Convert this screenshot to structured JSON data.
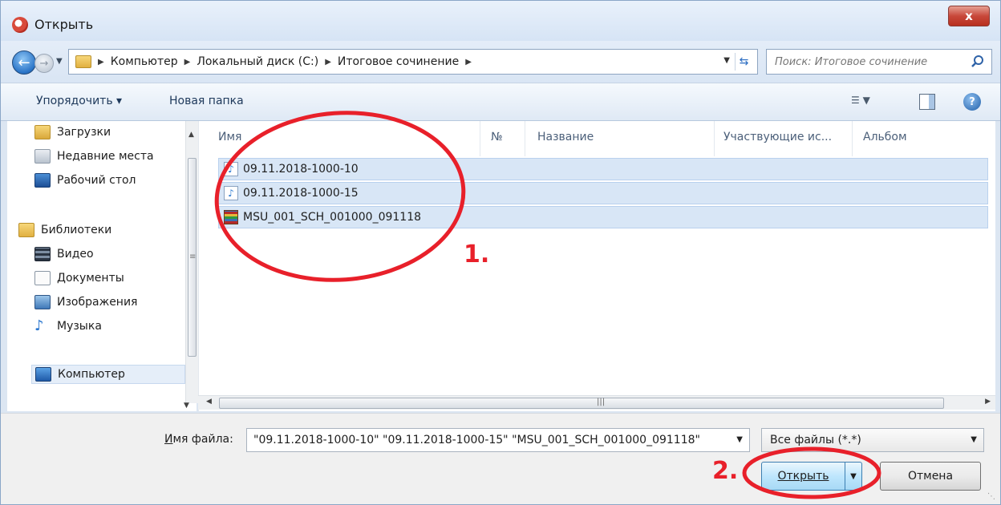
{
  "window": {
    "title": "Открыть",
    "close_symbol": "x"
  },
  "address": {
    "breadcrumbs": [
      "Компьютер",
      "Локальный диск (C:)",
      "Итоговое сочинение"
    ],
    "search_placeholder": "Поиск: Итоговое сочинение"
  },
  "toolbar": {
    "organize": "Упорядочить ▾",
    "new_folder": "Новая папка"
  },
  "nav": {
    "items": [
      {
        "label": "Загрузки",
        "icon": "downloads-icon"
      },
      {
        "label": "Недавние места",
        "icon": "recent-places-icon"
      },
      {
        "label": "Рабочий стол",
        "icon": "desktop-icon"
      },
      {
        "label": "Библиотеки",
        "icon": "libraries-icon"
      },
      {
        "label": "Видео",
        "icon": "video-icon"
      },
      {
        "label": "Документы",
        "icon": "documents-icon"
      },
      {
        "label": "Изображения",
        "icon": "images-icon"
      },
      {
        "label": "Музыка",
        "icon": "music-icon"
      },
      {
        "label": "Компьютер",
        "icon": "computer-icon"
      }
    ]
  },
  "files": {
    "columns": [
      "Имя",
      "№",
      "Название",
      "Участвующие ис...",
      "Альбом"
    ],
    "rows": [
      {
        "name": "09.11.2018-1000-10",
        "icon": "audio-file-icon"
      },
      {
        "name": "09.11.2018-1000-15",
        "icon": "audio-file-icon"
      },
      {
        "name": "MSU_001_SCH_001000_091118",
        "icon": "archive-file-icon"
      }
    ]
  },
  "bottom": {
    "filename_label_underlined": "И",
    "filename_label_rest": "мя файла:",
    "filename_value": "\"09.11.2018-1000-10\" \"09.11.2018-1000-15\" \"MSU_001_SCH_001000_091118\"",
    "filter": "Все файлы (*.*)",
    "open": "Открыть",
    "cancel": "Отмена"
  },
  "annotations": {
    "step1": "1.",
    "step2": "2.",
    "color": "#e8202a"
  }
}
